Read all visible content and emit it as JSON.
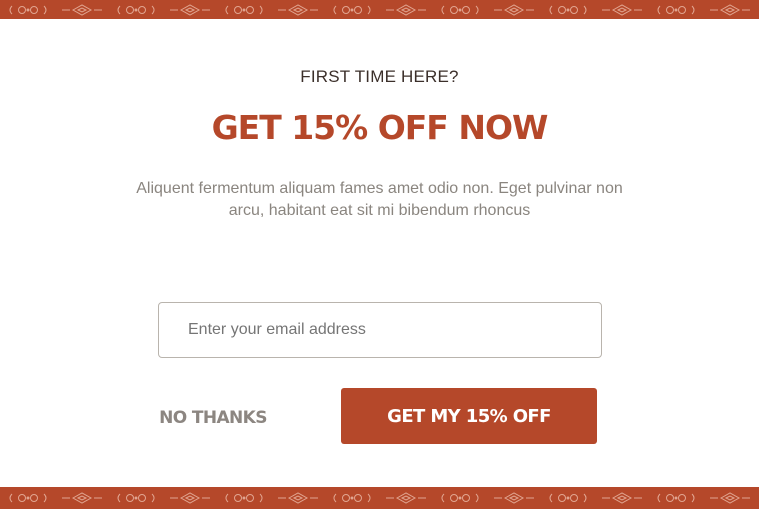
{
  "popup": {
    "eyebrow": "FIRST TIME HERE?",
    "headline": "GET 15% OFF NOW",
    "body": "Aliquent fermentum aliquam fames amet odio non. Eget pulvinar non arcu, habitant eat sit mi bibendum rhoncus",
    "email": {
      "placeholder": "Enter your email address",
      "value": ""
    },
    "decline_label": "NO THANKS",
    "cta_label": "GET MY 15% OFF"
  },
  "colors": {
    "accent": "#b5482a",
    "eyebrow_text": "#3b2f2a",
    "body_text": "#8a857f",
    "decline_text": "#8c8681",
    "cta_text": "#ffffff",
    "border_pattern": "#e9b6a3"
  },
  "decor": {
    "border_motif": "ethnic-ornament-pattern"
  }
}
